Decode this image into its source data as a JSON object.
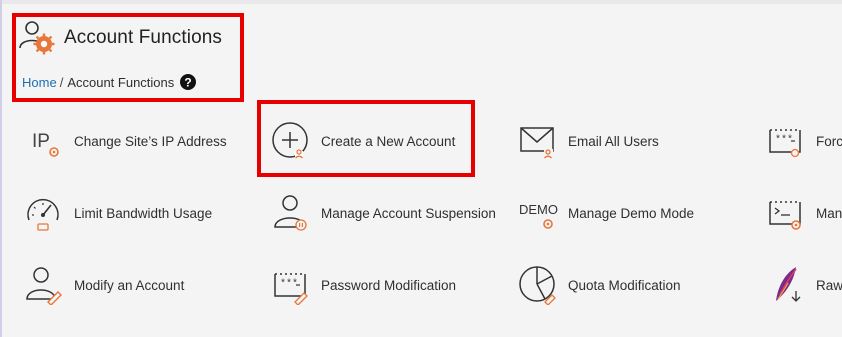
{
  "page": {
    "title": "Account Functions",
    "breadcrumb": {
      "home": "Home",
      "separator": "/",
      "current": "Account Functions"
    }
  },
  "accent_colors": {
    "orange": "#e8763a",
    "highlight": "#e60000",
    "link": "#1f6fb5"
  },
  "icons": {
    "change-ip": {
      "text": "IP"
    },
    "demo": {
      "text": "DEMO"
    }
  },
  "grid": [
    {
      "label": "Change Site’s IP Address",
      "icon": "ip-icon"
    },
    {
      "label": "Create a New Account",
      "icon": "plus-circle-icon"
    },
    {
      "label": "Email All Users",
      "icon": "envelope-icon"
    },
    {
      "label": "Force",
      "icon": "password-terminal-icon"
    },
    {
      "label": "Limit Bandwidth Usage",
      "icon": "speedometer-icon"
    },
    {
      "label": "Manage Account Suspension",
      "icon": "user-pause-icon"
    },
    {
      "label": "Manage Demo Mode",
      "icon": "demo-icon"
    },
    {
      "label": "Man",
      "icon": "terminal-icon"
    },
    {
      "label": "Modify an Account",
      "icon": "user-edit-icon"
    },
    {
      "label": "Password Modification",
      "icon": "password-field-icon"
    },
    {
      "label": "Quota Modification",
      "icon": "pie-chart-icon"
    },
    {
      "label": "Raw",
      "icon": "feather-icon"
    }
  ]
}
